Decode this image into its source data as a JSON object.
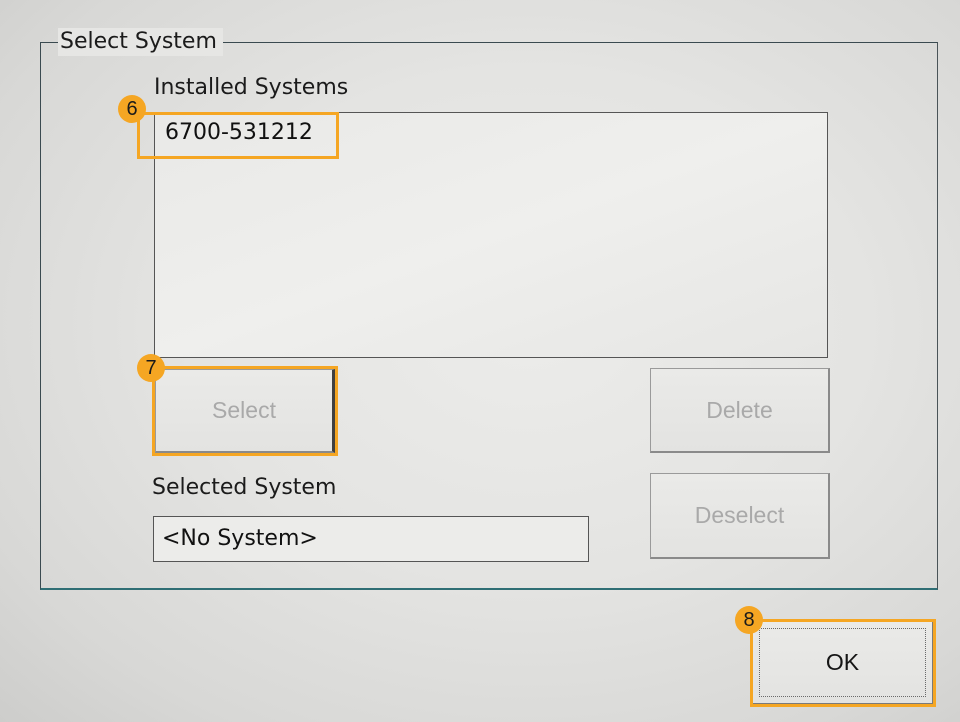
{
  "dialog": {
    "group_title": "Select System",
    "installed_label": "Installed Systems",
    "installed_items": [
      "6700-531212"
    ],
    "selected_label": "Selected System",
    "selected_value": "<No System>"
  },
  "buttons": {
    "select": "Select",
    "delete": "Delete",
    "deselect": "Deselect",
    "ok": "OK"
  },
  "annotations": {
    "badge_6": "6",
    "badge_7": "7",
    "badge_8": "8",
    "color": "#f5a623"
  },
  "icons": []
}
